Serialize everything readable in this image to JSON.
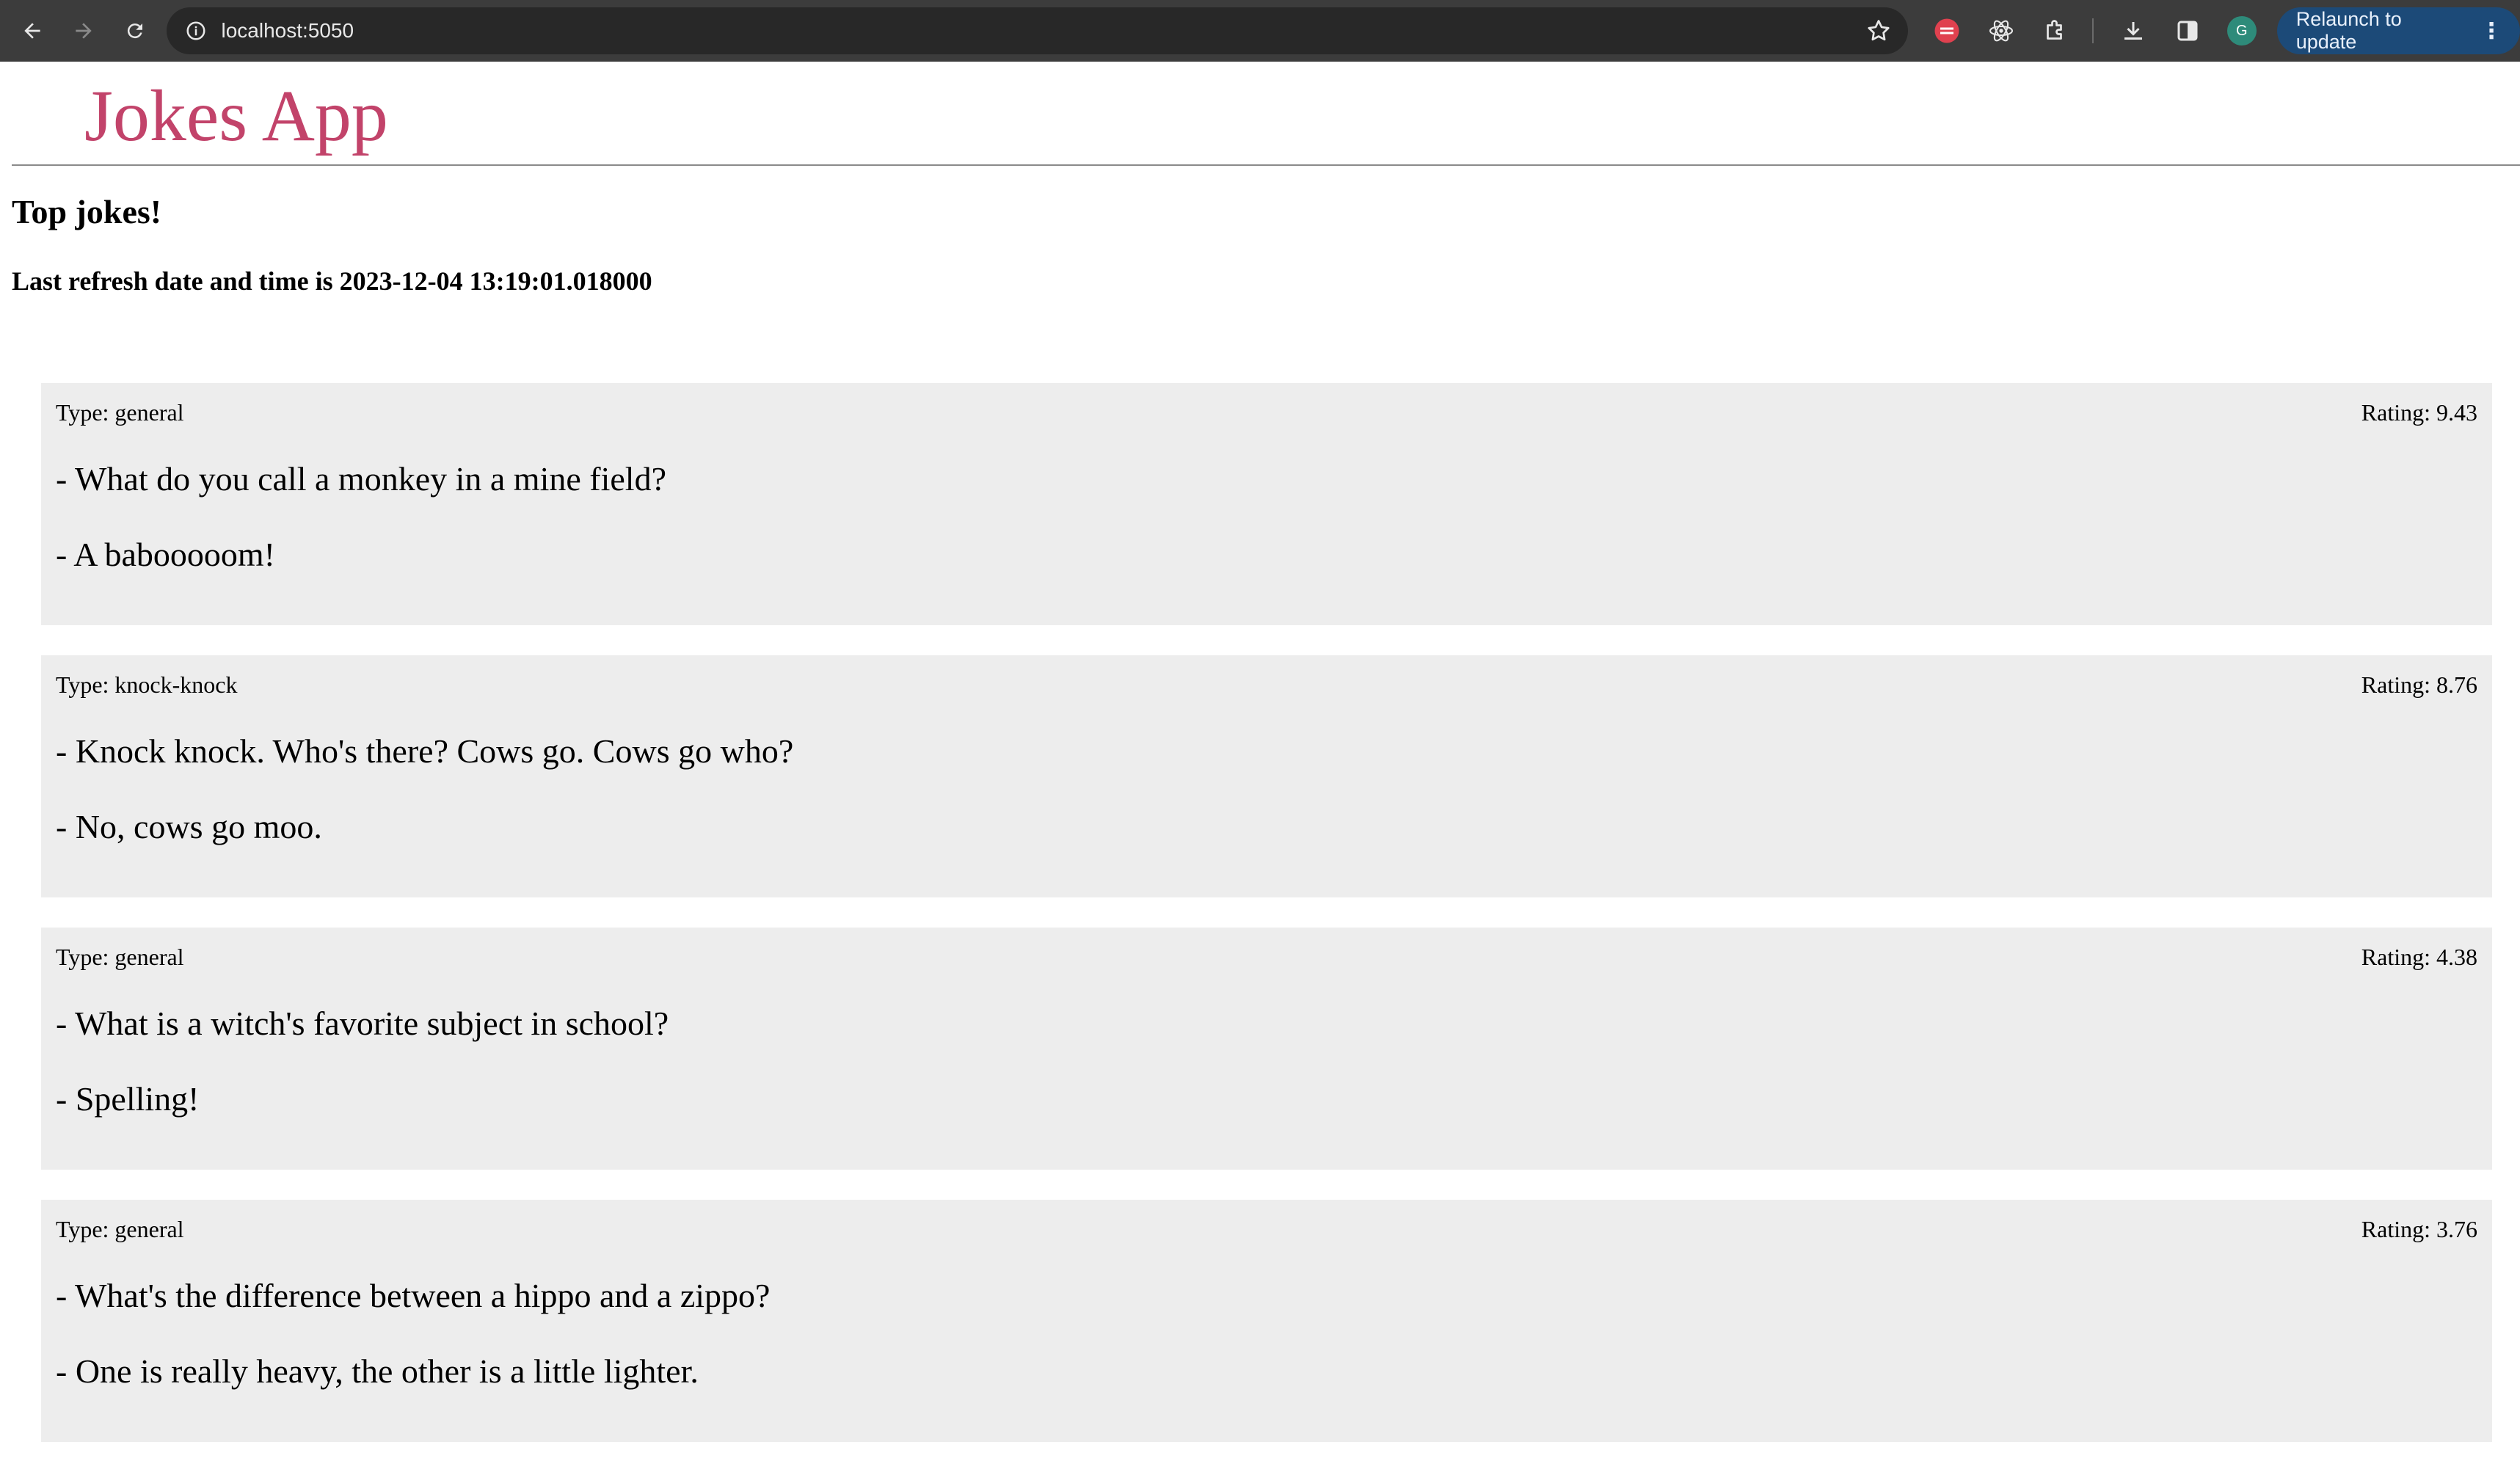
{
  "browser": {
    "url": "localhost:5050",
    "relaunch_label": "Relaunch to update",
    "avatar_initial": "G"
  },
  "app": {
    "title": "Jokes App",
    "heading": "Top jokes!",
    "refresh_text": "Last refresh date and time is 2023-12-04 13:19:01.018000"
  },
  "jokes": [
    {
      "type": "Type: general",
      "rating": "Rating: 9.43",
      "setup": "- What do you call a monkey in a mine field?",
      "punchline": "- A babooooom!"
    },
    {
      "type": "Type: knock-knock",
      "rating": "Rating: 8.76",
      "setup": "- Knock knock. Who's there? Cows go. Cows go who?",
      "punchline": "- No, cows go moo."
    },
    {
      "type": "Type: general",
      "rating": "Rating: 4.38",
      "setup": "- What is a witch's favorite subject in school?",
      "punchline": "- Spelling!"
    },
    {
      "type": "Type: general",
      "rating": "Rating: 3.76",
      "setup": "- What's the difference between a hippo and a zippo?",
      "punchline": "- One is really heavy, the other is a little lighter."
    }
  ]
}
